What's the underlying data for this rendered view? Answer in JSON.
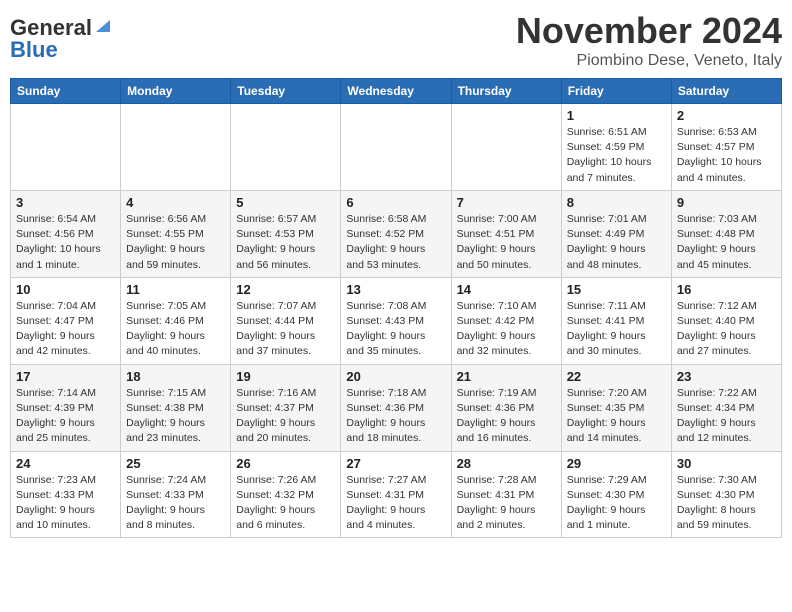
{
  "header": {
    "logo_line1": "General",
    "logo_line2": "Blue",
    "month": "November 2024",
    "location": "Piombino Dese, Veneto, Italy"
  },
  "days_of_week": [
    "Sunday",
    "Monday",
    "Tuesday",
    "Wednesday",
    "Thursday",
    "Friday",
    "Saturday"
  ],
  "weeks": [
    [
      {
        "day": "",
        "info": ""
      },
      {
        "day": "",
        "info": ""
      },
      {
        "day": "",
        "info": ""
      },
      {
        "day": "",
        "info": ""
      },
      {
        "day": "",
        "info": ""
      },
      {
        "day": "1",
        "info": "Sunrise: 6:51 AM\nSunset: 4:59 PM\nDaylight: 10 hours and 7 minutes."
      },
      {
        "day": "2",
        "info": "Sunrise: 6:53 AM\nSunset: 4:57 PM\nDaylight: 10 hours and 4 minutes."
      }
    ],
    [
      {
        "day": "3",
        "info": "Sunrise: 6:54 AM\nSunset: 4:56 PM\nDaylight: 10 hours and 1 minute."
      },
      {
        "day": "4",
        "info": "Sunrise: 6:56 AM\nSunset: 4:55 PM\nDaylight: 9 hours and 59 minutes."
      },
      {
        "day": "5",
        "info": "Sunrise: 6:57 AM\nSunset: 4:53 PM\nDaylight: 9 hours and 56 minutes."
      },
      {
        "day": "6",
        "info": "Sunrise: 6:58 AM\nSunset: 4:52 PM\nDaylight: 9 hours and 53 minutes."
      },
      {
        "day": "7",
        "info": "Sunrise: 7:00 AM\nSunset: 4:51 PM\nDaylight: 9 hours and 50 minutes."
      },
      {
        "day": "8",
        "info": "Sunrise: 7:01 AM\nSunset: 4:49 PM\nDaylight: 9 hours and 48 minutes."
      },
      {
        "day": "9",
        "info": "Sunrise: 7:03 AM\nSunset: 4:48 PM\nDaylight: 9 hours and 45 minutes."
      }
    ],
    [
      {
        "day": "10",
        "info": "Sunrise: 7:04 AM\nSunset: 4:47 PM\nDaylight: 9 hours and 42 minutes."
      },
      {
        "day": "11",
        "info": "Sunrise: 7:05 AM\nSunset: 4:46 PM\nDaylight: 9 hours and 40 minutes."
      },
      {
        "day": "12",
        "info": "Sunrise: 7:07 AM\nSunset: 4:44 PM\nDaylight: 9 hours and 37 minutes."
      },
      {
        "day": "13",
        "info": "Sunrise: 7:08 AM\nSunset: 4:43 PM\nDaylight: 9 hours and 35 minutes."
      },
      {
        "day": "14",
        "info": "Sunrise: 7:10 AM\nSunset: 4:42 PM\nDaylight: 9 hours and 32 minutes."
      },
      {
        "day": "15",
        "info": "Sunrise: 7:11 AM\nSunset: 4:41 PM\nDaylight: 9 hours and 30 minutes."
      },
      {
        "day": "16",
        "info": "Sunrise: 7:12 AM\nSunset: 4:40 PM\nDaylight: 9 hours and 27 minutes."
      }
    ],
    [
      {
        "day": "17",
        "info": "Sunrise: 7:14 AM\nSunset: 4:39 PM\nDaylight: 9 hours and 25 minutes."
      },
      {
        "day": "18",
        "info": "Sunrise: 7:15 AM\nSunset: 4:38 PM\nDaylight: 9 hours and 23 minutes."
      },
      {
        "day": "19",
        "info": "Sunrise: 7:16 AM\nSunset: 4:37 PM\nDaylight: 9 hours and 20 minutes."
      },
      {
        "day": "20",
        "info": "Sunrise: 7:18 AM\nSunset: 4:36 PM\nDaylight: 9 hours and 18 minutes."
      },
      {
        "day": "21",
        "info": "Sunrise: 7:19 AM\nSunset: 4:36 PM\nDaylight: 9 hours and 16 minutes."
      },
      {
        "day": "22",
        "info": "Sunrise: 7:20 AM\nSunset: 4:35 PM\nDaylight: 9 hours and 14 minutes."
      },
      {
        "day": "23",
        "info": "Sunrise: 7:22 AM\nSunset: 4:34 PM\nDaylight: 9 hours and 12 minutes."
      }
    ],
    [
      {
        "day": "24",
        "info": "Sunrise: 7:23 AM\nSunset: 4:33 PM\nDaylight: 9 hours and 10 minutes."
      },
      {
        "day": "25",
        "info": "Sunrise: 7:24 AM\nSunset: 4:33 PM\nDaylight: 9 hours and 8 minutes."
      },
      {
        "day": "26",
        "info": "Sunrise: 7:26 AM\nSunset: 4:32 PM\nDaylight: 9 hours and 6 minutes."
      },
      {
        "day": "27",
        "info": "Sunrise: 7:27 AM\nSunset: 4:31 PM\nDaylight: 9 hours and 4 minutes."
      },
      {
        "day": "28",
        "info": "Sunrise: 7:28 AM\nSunset: 4:31 PM\nDaylight: 9 hours and 2 minutes."
      },
      {
        "day": "29",
        "info": "Sunrise: 7:29 AM\nSunset: 4:30 PM\nDaylight: 9 hours and 1 minute."
      },
      {
        "day": "30",
        "info": "Sunrise: 7:30 AM\nSunset: 4:30 PM\nDaylight: 8 hours and 59 minutes."
      }
    ]
  ]
}
